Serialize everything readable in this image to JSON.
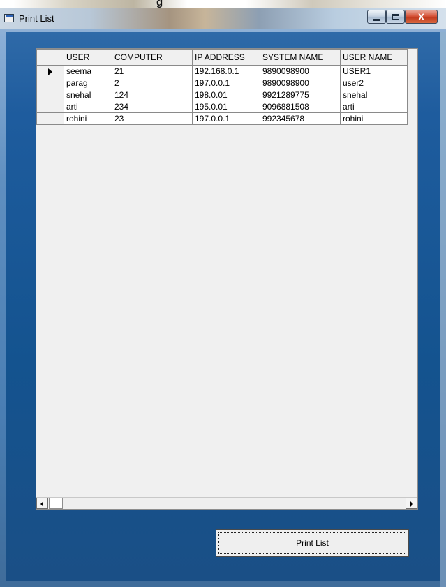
{
  "window": {
    "title": "Print List",
    "close_glyph": "X"
  },
  "grid": {
    "columns": [
      "USER",
      "COMPUTER",
      "IP ADDRESS",
      "SYSTEM NAME",
      "USER NAME"
    ],
    "rows": [
      [
        "seema",
        "21",
        "192.168.0.1",
        "9890098900",
        "USER1"
      ],
      [
        "parag",
        "2",
        "197.0.0.1",
        "9890098900",
        "user2"
      ],
      [
        "snehal",
        "124",
        "198.0.01",
        "9921289775",
        "snehal"
      ],
      [
        "arti",
        "234",
        "195.0.01",
        "9096881508",
        "arti"
      ],
      [
        "rohini",
        "23",
        "197.0.0.1",
        "992345678",
        "rohini"
      ]
    ],
    "current_row_indicator": "row-pointer-icon"
  },
  "buttons": {
    "print_label": "Print List"
  },
  "icons": {
    "app": "form-icon",
    "minimize": "minimize-icon",
    "maximize": "maximize-icon",
    "close": "close-icon",
    "scroll_left": "scroll-left-arrow-icon",
    "scroll_right": "scroll-right-arrow-icon"
  },
  "colors": {
    "client_background": "#1e5c9e",
    "close_button": "#c23a1f"
  }
}
